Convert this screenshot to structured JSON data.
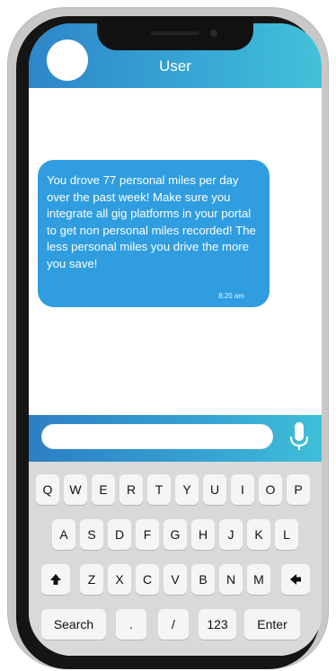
{
  "header": {
    "title": "User"
  },
  "message": {
    "text": "You drove 77 personal miles per day over the past week! Make sure you integrate all gig platforms in your portal to get non personal miles recorded! The less personal miles you drive the more you save!",
    "time": "8:20 am"
  },
  "keyboard": {
    "row1": [
      "Q",
      "W",
      "E",
      "R",
      "T",
      "Y",
      "U",
      "I",
      "O",
      "P"
    ],
    "row2": [
      "A",
      "S",
      "D",
      "F",
      "G",
      "H",
      "J",
      "K",
      "L"
    ],
    "row3": [
      "Z",
      "X",
      "C",
      "V",
      "B",
      "N",
      "M"
    ],
    "row4": [
      "Search",
      ".",
      "/",
      "123",
      "Enter"
    ]
  },
  "colors": {
    "accent": "#2f9de0",
    "header_start": "#2e86c8",
    "header_end": "#42c2d8"
  }
}
